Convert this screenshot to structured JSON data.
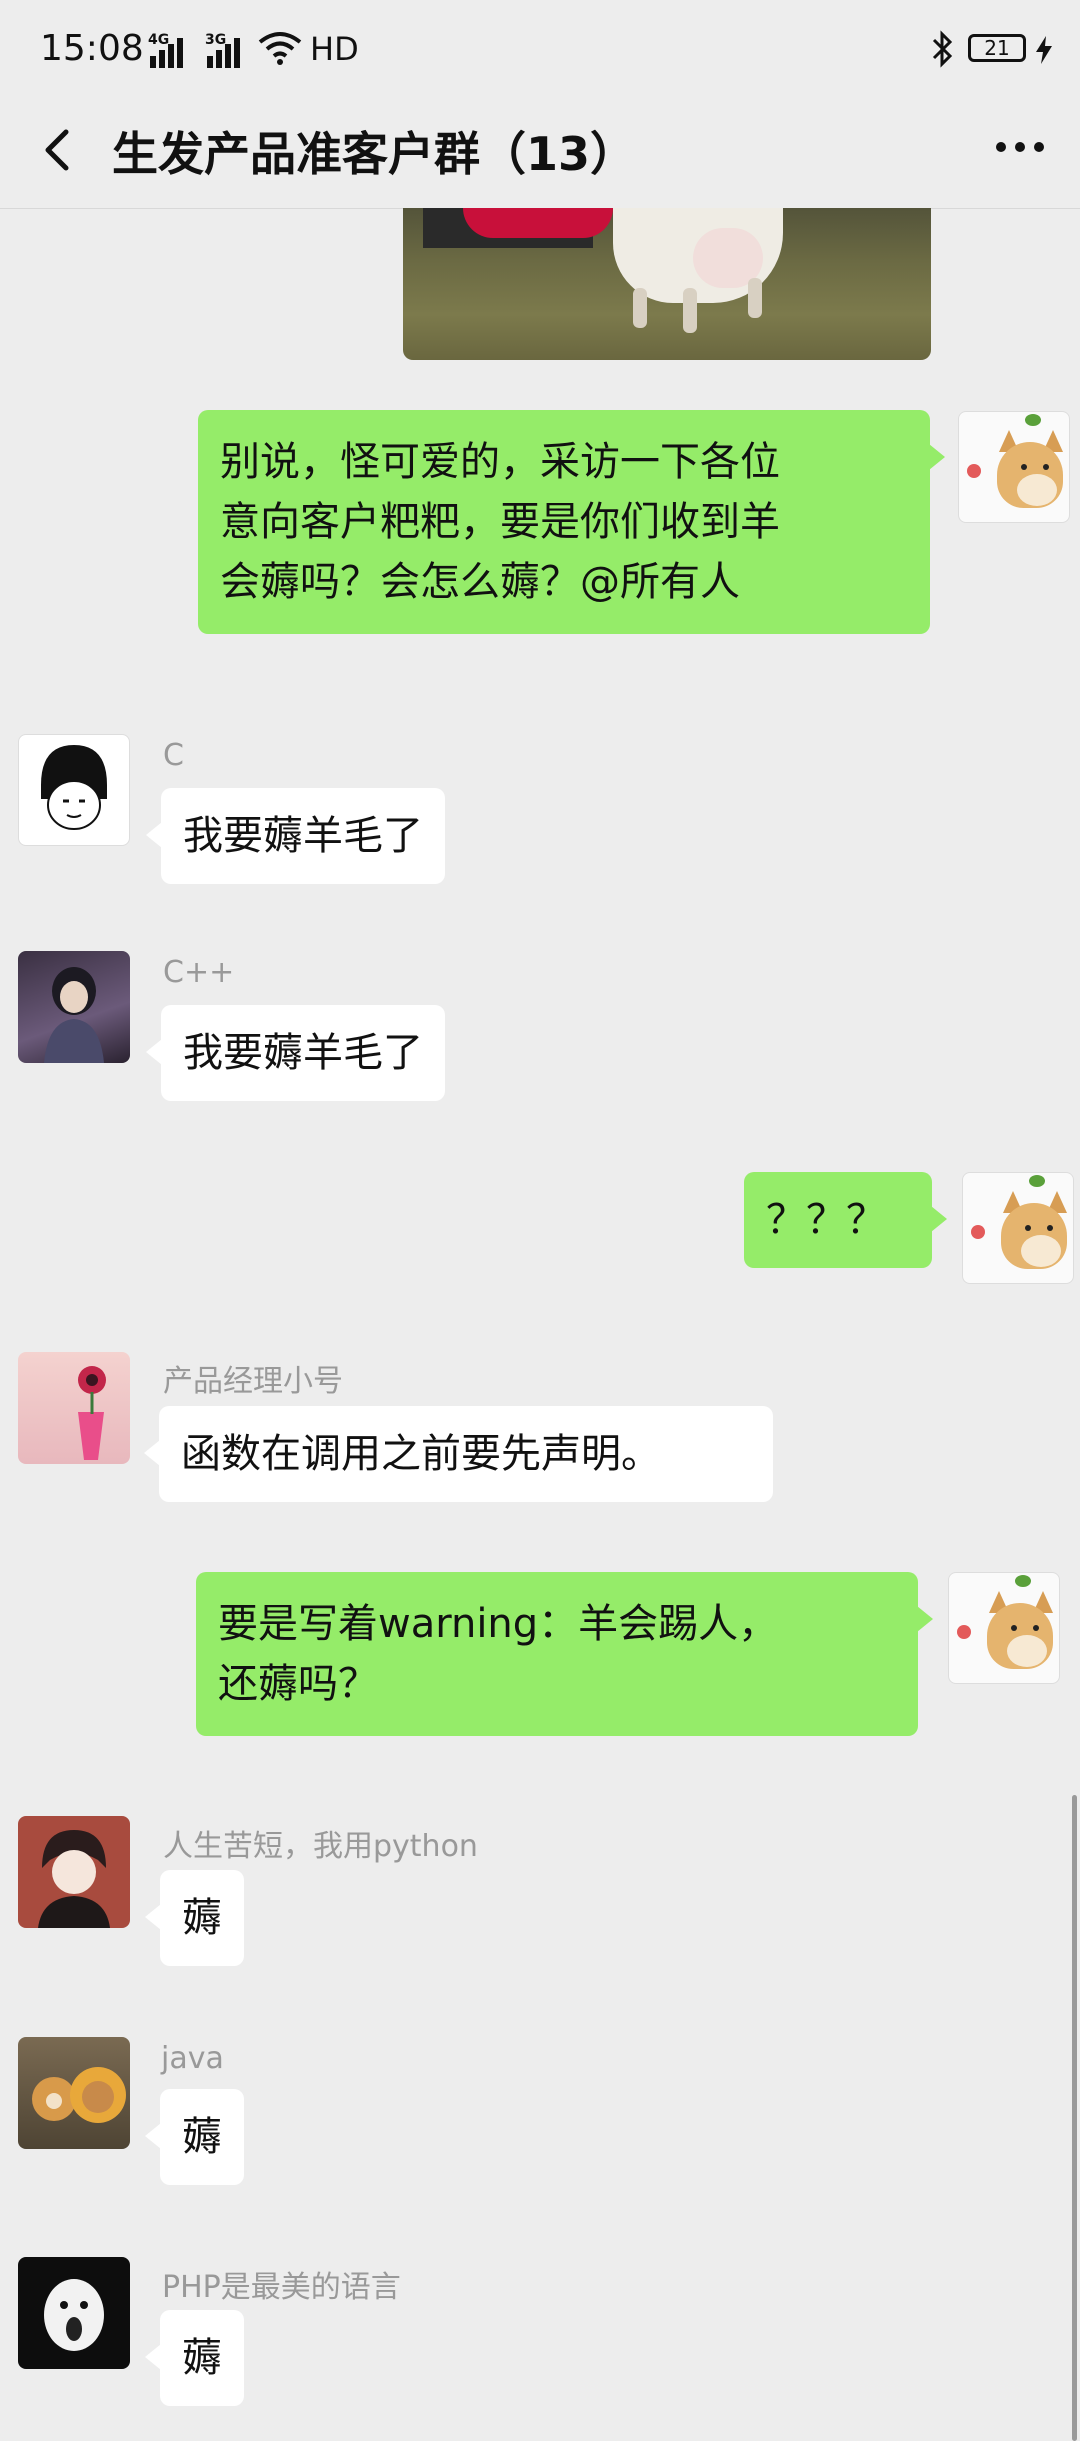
{
  "status_bar": {
    "time": "15:08",
    "sig1": "4G",
    "sig2": "3G",
    "hd": "HD",
    "battery": "21"
  },
  "header": {
    "title": "生发产品准客户群（13）"
  },
  "messages": [
    {
      "side": "right",
      "text_lines": [
        "别说，怪可爱的，采访一下各位",
        "意向客户粑粑，要是你们收到羊",
        "会薅吗？会怎么薅？@所有人"
      ]
    },
    {
      "side": "left",
      "nick": "C",
      "text": "我要薅羊毛了"
    },
    {
      "side": "left",
      "nick": "C++",
      "text": "我要薅羊毛了"
    },
    {
      "side": "right",
      "text": "？？？"
    },
    {
      "side": "left",
      "nick": "产品经理小号",
      "text": "函数在调用之前要先声明。"
    },
    {
      "side": "right",
      "text_lines": [
        "要是写着warning：羊会踢人，",
        "还薅吗？"
      ]
    },
    {
      "side": "left",
      "nick": "人生苦短，我用python",
      "text": "薅"
    },
    {
      "side": "left",
      "nick": "java",
      "text": "薅"
    },
    {
      "side": "left",
      "nick": "PHP是最美的语言",
      "text": "薅"
    }
  ],
  "colors": {
    "background": "#ededed",
    "sent_bubble": "#95ec69",
    "received_bubble": "#ffffff"
  }
}
